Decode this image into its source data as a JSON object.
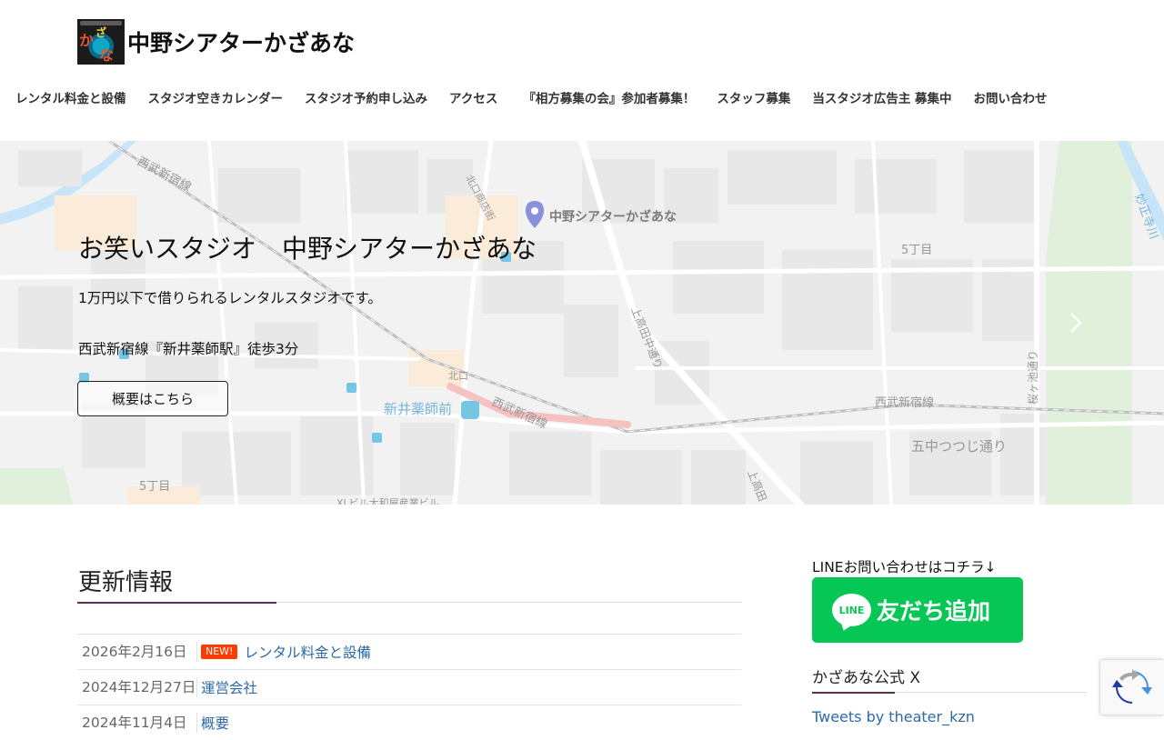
{
  "site": {
    "logo_text": "中野シアターかざあな"
  },
  "nav": {
    "items": [
      {
        "label": "レンタル料金と設備"
      },
      {
        "label": "スタジオ空きカレンダー"
      },
      {
        "label": "スタジオ予約申し込み"
      },
      {
        "label": "アクセス"
      },
      {
        "label": "『相方募集の会』参加者募集！"
      },
      {
        "label": "スタッフ募集"
      },
      {
        "label": "当スタジオ広告主 募集中"
      },
      {
        "label": "お問い合わせ"
      }
    ]
  },
  "hero": {
    "title": "お笑いスタジオ　中野シアターかざあな",
    "line1": "1万円以下で借りられるレンタルスタジオです。",
    "line2": "西武新宿線『新井薬師駅』徒歩3分",
    "button_label": "概要はこちら",
    "next_icon": "chevron-right-icon"
  },
  "map": {
    "labels": {
      "rail_top": "西武新宿線",
      "kitaguchi_shotengai": "北口商店街",
      "pin_label": "中野シアターかざあな",
      "chome5_right": "5丁目",
      "kamitakada_naka": "上高田中通り",
      "kitaguchi": "北口",
      "station": "新井薬師前",
      "rail_mid": "西武新宿線",
      "rail_right": "西武新宿線",
      "sakuragaike": "桜ヶ池通り",
      "gochu": "五中つつじ通り",
      "chome5_left": "5丁目",
      "kamitakada_bottom": "上高田",
      "building": "XLビル大和屋産業ビル",
      "myoshoji": "妙正寺川"
    },
    "colors": {
      "land": "#ebebeb",
      "block": "#dcdcdc",
      "road": "#ffffff",
      "rail_highlight": "#f2a0a0",
      "park": "#cfe8c8",
      "water": "#a9d6f5"
    }
  },
  "news": {
    "heading": "更新情報",
    "badge_new": "NEW!",
    "rows": [
      {
        "date": "2026年2月16日",
        "title": "レンタル料金と設備",
        "is_new": true
      },
      {
        "date": "2024年12月27日",
        "title": "運営会社",
        "is_new": false
      },
      {
        "date": "2024年11月4日",
        "title": "概要",
        "is_new": false
      }
    ]
  },
  "sidebar": {
    "line_label": "LINEお問い合わせはコチラ↓",
    "line_icon_text": "LINE",
    "line_button_text": "友だち追加",
    "x_heading": "かざあな公式 X",
    "tweets_link": "Tweets by theater_kzn"
  },
  "theme": {
    "accent": "#5c2e52",
    "link": "#2c6aa8",
    "line_green": "#06c755",
    "new_badge": "#ff3b00"
  }
}
